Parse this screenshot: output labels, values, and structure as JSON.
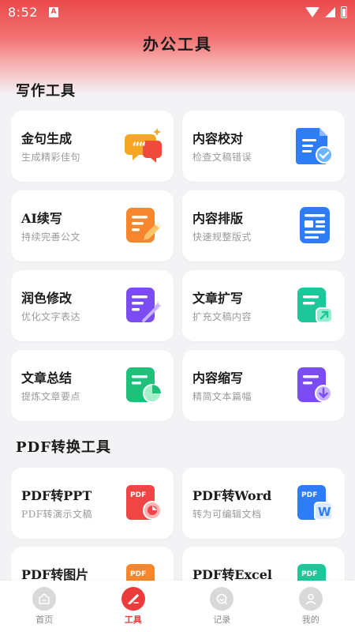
{
  "status_bar": {
    "time": "8:52",
    "notif_letter": "A"
  },
  "header": {
    "title": "办公工具"
  },
  "sections": {
    "writing": {
      "title": "写作工具",
      "cards": [
        {
          "title": "金句生成",
          "subtitle": "生成精彩佳句",
          "icon": "quote-bubble-icon"
        },
        {
          "title": "内容校对",
          "subtitle": "检查文稿错误",
          "icon": "document-check-icon"
        },
        {
          "title": "AI续写",
          "subtitle": "持续完善公文",
          "icon": "document-pen-icon"
        },
        {
          "title": "内容排版",
          "subtitle": "快速规整版式",
          "icon": "document-layout-icon"
        },
        {
          "title": "润色修改",
          "subtitle": "优化文字表达",
          "icon": "document-magic-icon"
        },
        {
          "title": "文章扩写",
          "subtitle": "扩充文稿内容",
          "icon": "document-expand-icon"
        },
        {
          "title": "文章总结",
          "subtitle": "提炼文章要点",
          "icon": "document-chart-icon"
        },
        {
          "title": "内容缩写",
          "subtitle": "精简文本篇幅",
          "icon": "document-shrink-icon"
        }
      ]
    },
    "pdf": {
      "title": "PDF转换工具",
      "cards": [
        {
          "title": "PDF转PPT",
          "subtitle": "PDF转演示文稿",
          "icon": "pdf-ppt-icon",
          "badge": "PDF"
        },
        {
          "title": "PDF转Word",
          "subtitle": "转为可编辑文档",
          "icon": "pdf-word-icon",
          "badge": "PDF",
          "letter": "W"
        },
        {
          "title": "PDF转图片",
          "subtitle": "",
          "icon": "pdf-image-icon",
          "badge": "PDF"
        },
        {
          "title": "PDF转Excel",
          "subtitle": "",
          "icon": "pdf-excel-icon",
          "badge": "PDF"
        }
      ]
    }
  },
  "bottom_nav": [
    {
      "label": "首页",
      "icon": "home-icon",
      "active": false
    },
    {
      "label": "工具",
      "icon": "tools-icon",
      "active": true
    },
    {
      "label": "记录",
      "icon": "history-icon",
      "active": false
    },
    {
      "label": "我的",
      "icon": "profile-icon",
      "active": false
    }
  ],
  "colors": {
    "accent": "#ec3b3b",
    "header_top": "#ec4a4a",
    "background": "#f3f3f5"
  }
}
